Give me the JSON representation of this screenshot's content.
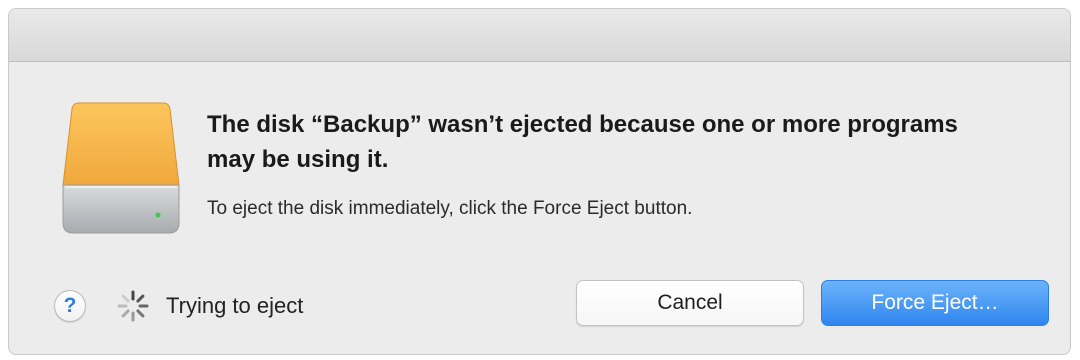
{
  "dialog": {
    "title": "The disk “Backup” wasn’t ejected because one or more programs may be using it.",
    "message": "To eject the disk immediately, click the Force Eject button.",
    "icon": "external-disk-icon",
    "colors": {
      "disk_top": "#f6b64a",
      "disk_body": "#bfc2c4",
      "disk_led": "#3ec45b",
      "accent": "#2f86f0"
    }
  },
  "footer": {
    "help_label": "?",
    "help_icon": "question-mark-icon",
    "status_icon": "spinner-icon",
    "status_text": "Trying to eject"
  },
  "buttons": {
    "cancel_label": "Cancel",
    "force_eject_label": "Force Eject…"
  }
}
